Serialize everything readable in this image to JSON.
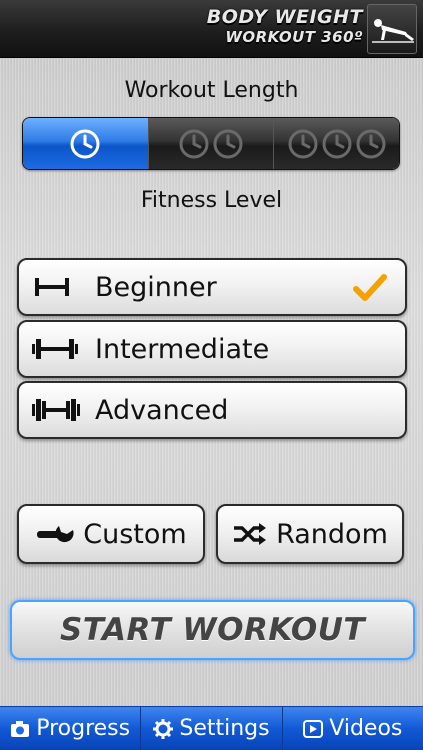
{
  "app": {
    "logo_line1": "BODY WEIGHT",
    "logo_line2": "WORKOUT 360º",
    "logo_icon": "pushup-figure-icon"
  },
  "workout_length": {
    "title": "Workout Length",
    "options": [
      {
        "icon": "clock-icon",
        "clocks": 1,
        "selected": true
      },
      {
        "icon": "clock-icon",
        "clocks": 2,
        "selected": false
      },
      {
        "icon": "clock-icon",
        "clocks": 3,
        "selected": false
      }
    ]
  },
  "fitness_level": {
    "title": "Fitness Level",
    "options": [
      {
        "label": "Beginner",
        "icon": "dumbbell-light-icon",
        "selected": true
      },
      {
        "label": "Intermediate",
        "icon": "dumbbell-medium-icon",
        "selected": false
      },
      {
        "label": "Advanced",
        "icon": "dumbbell-heavy-icon",
        "selected": false
      }
    ]
  },
  "actions": {
    "custom_label": "Custom",
    "custom_icon": "wrench-icon",
    "random_label": "Random",
    "random_icon": "shuffle-icon",
    "start_label": "START WORKOUT"
  },
  "tabbar": {
    "items": [
      {
        "label": "Progress",
        "icon": "camera-icon"
      },
      {
        "label": "Settings",
        "icon": "gear-icon"
      },
      {
        "label": "Videos",
        "icon": "play-icon"
      }
    ]
  },
  "colors": {
    "accent_blue": "#1c6be0",
    "check_orange": "#f5a200",
    "header_dark": "#1e1e1e"
  }
}
